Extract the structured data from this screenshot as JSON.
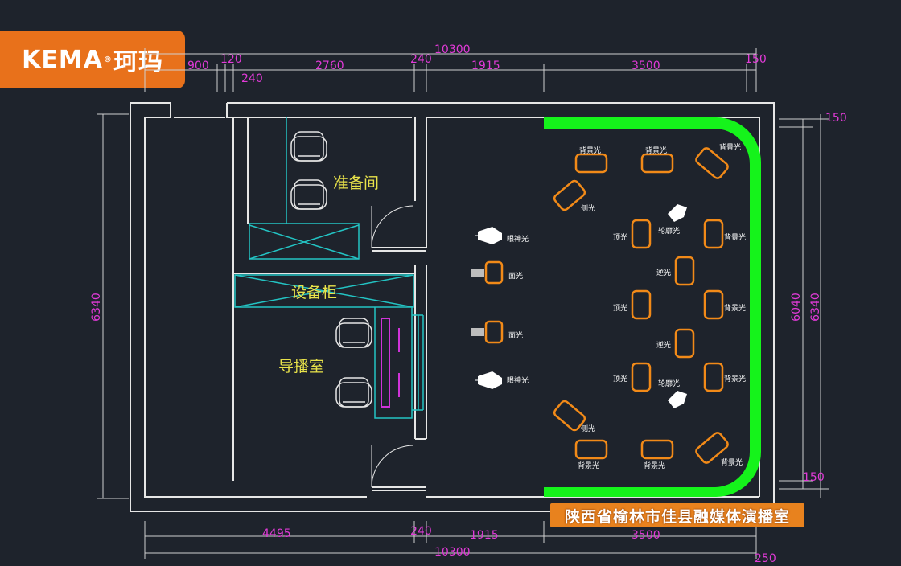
{
  "logo": {
    "brand": "KEMA",
    "reg_mark": "®",
    "brand_cn": "珂玛"
  },
  "caption": "陕西省榆林市佳县融媒体演播室",
  "rooms": {
    "prep": "准备间",
    "cabinet": "设备柜",
    "director": "导播室"
  },
  "dimensions": {
    "top_total": "10300",
    "top_segments": [
      "900",
      "120",
      "240",
      "2760",
      "240",
      "1915",
      "3500",
      "150"
    ],
    "bottom_total": "10300",
    "bottom_segments": [
      "4495",
      "240",
      "1915",
      "3500",
      "250"
    ],
    "left_height": "6340",
    "right_inner": "6040",
    "right_outer": "6340",
    "right_top": "150",
    "right_bottom": "150"
  },
  "light_labels": {
    "eye_light": "眼神光",
    "face_light": "面光",
    "side_light": "侧光",
    "top_light": "顶光",
    "contour_light": "轮廓光",
    "back_light": "逆光",
    "backdrop_light": "背景光"
  },
  "colors": {
    "wall": "#e6e6e6",
    "cyan": "#23c4c4",
    "green_screen": "#15f31b",
    "light": "#f28a18",
    "dimension": "#e23ad8",
    "room_label": "#e8e24a",
    "brand": "#e8711b"
  }
}
